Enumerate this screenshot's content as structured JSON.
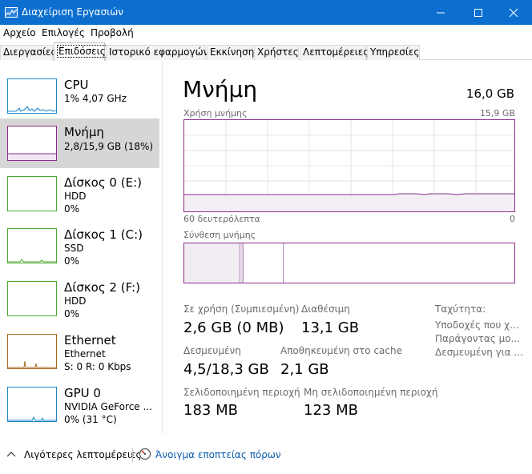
{
  "window": {
    "title": "Διαχείριση Εργασιών"
  },
  "menu": [
    "Αρχείο",
    "Επιλογές",
    "Προβολή"
  ],
  "tabs": [
    {
      "label": "Διεργασίες"
    },
    {
      "label": "Επιδόσεις",
      "active": true
    },
    {
      "label": "Ιστορικό εφαρμογών"
    },
    {
      "label": "Εκκίνηση"
    },
    {
      "label": "Χρήστες"
    },
    {
      "label": "Λεπτομέρειες"
    },
    {
      "label": "Υπηρεσίες"
    }
  ],
  "sidebar": [
    {
      "title": "CPU",
      "line1": "1% 4,07 GHz",
      "line2": "",
      "color": "#1e88c7"
    },
    {
      "title": "Μνήμη",
      "line1": "2,8/15,9 GB (18%)",
      "line2": "",
      "color": "#8b2e8b",
      "active": true
    },
    {
      "title": "Δίσκος 0 (E:)",
      "line1": "HDD",
      "line2": "0%",
      "color": "#4ca82d"
    },
    {
      "title": "Δίσκος 1 (C:)",
      "line1": "SSD",
      "line2": "0%",
      "color": "#4ca82d"
    },
    {
      "title": "Δίσκος 2 (F:)",
      "line1": "HDD",
      "line2": "0%",
      "color": "#4ca82d"
    },
    {
      "title": "Ethernet",
      "line1": "Ethernet",
      "line2": "S: 0 R: 0 Kbps",
      "color": "#a86a1e"
    },
    {
      "title": "GPU 0",
      "line1": "NVIDIA GeForce ...",
      "line2": "0% (31 °C)",
      "color": "#1e88c7"
    }
  ],
  "main": {
    "title": "Μνήμη",
    "total": "16,0 GB",
    "usage_label": "Χρήση μνήμης",
    "usage_max": "15,9 GB",
    "time_left": "60 δευτερόλεπτα",
    "time_right": "0",
    "composition_label": "Σύνθεση μνήμης",
    "usage_fraction": 0.18,
    "stats": {
      "in_use_label": "Σε χρήση (Συμπιεσμένη)",
      "in_use_value": "2,6 GB (0 MB)",
      "available_label": "Διαθέσιμη",
      "available_value": "13,1 GB",
      "committed_label": "Δεσμευμένη",
      "committed_value": "4,5/18,3 GB",
      "cached_label": "Αποθηκευμένη στο cache",
      "cached_value": "2,1 GB",
      "paged_label": "Σελιδοποιημένη περιοχή",
      "paged_value": "183 MB",
      "nonpaged_label": "Μη σελιδοποιημένη περιοχή",
      "nonpaged_value": "123 MB"
    },
    "right": [
      "Ταχύτητα:",
      "Υποδοχές που χ...",
      "Παράγοντας μο...",
      "Δεσμευμένη για ..."
    ]
  },
  "footer": {
    "less_details": "Λιγότερες λεπτομέρειες",
    "open_monitor": "Άνοιγμα εποπτείας πόρων"
  }
}
